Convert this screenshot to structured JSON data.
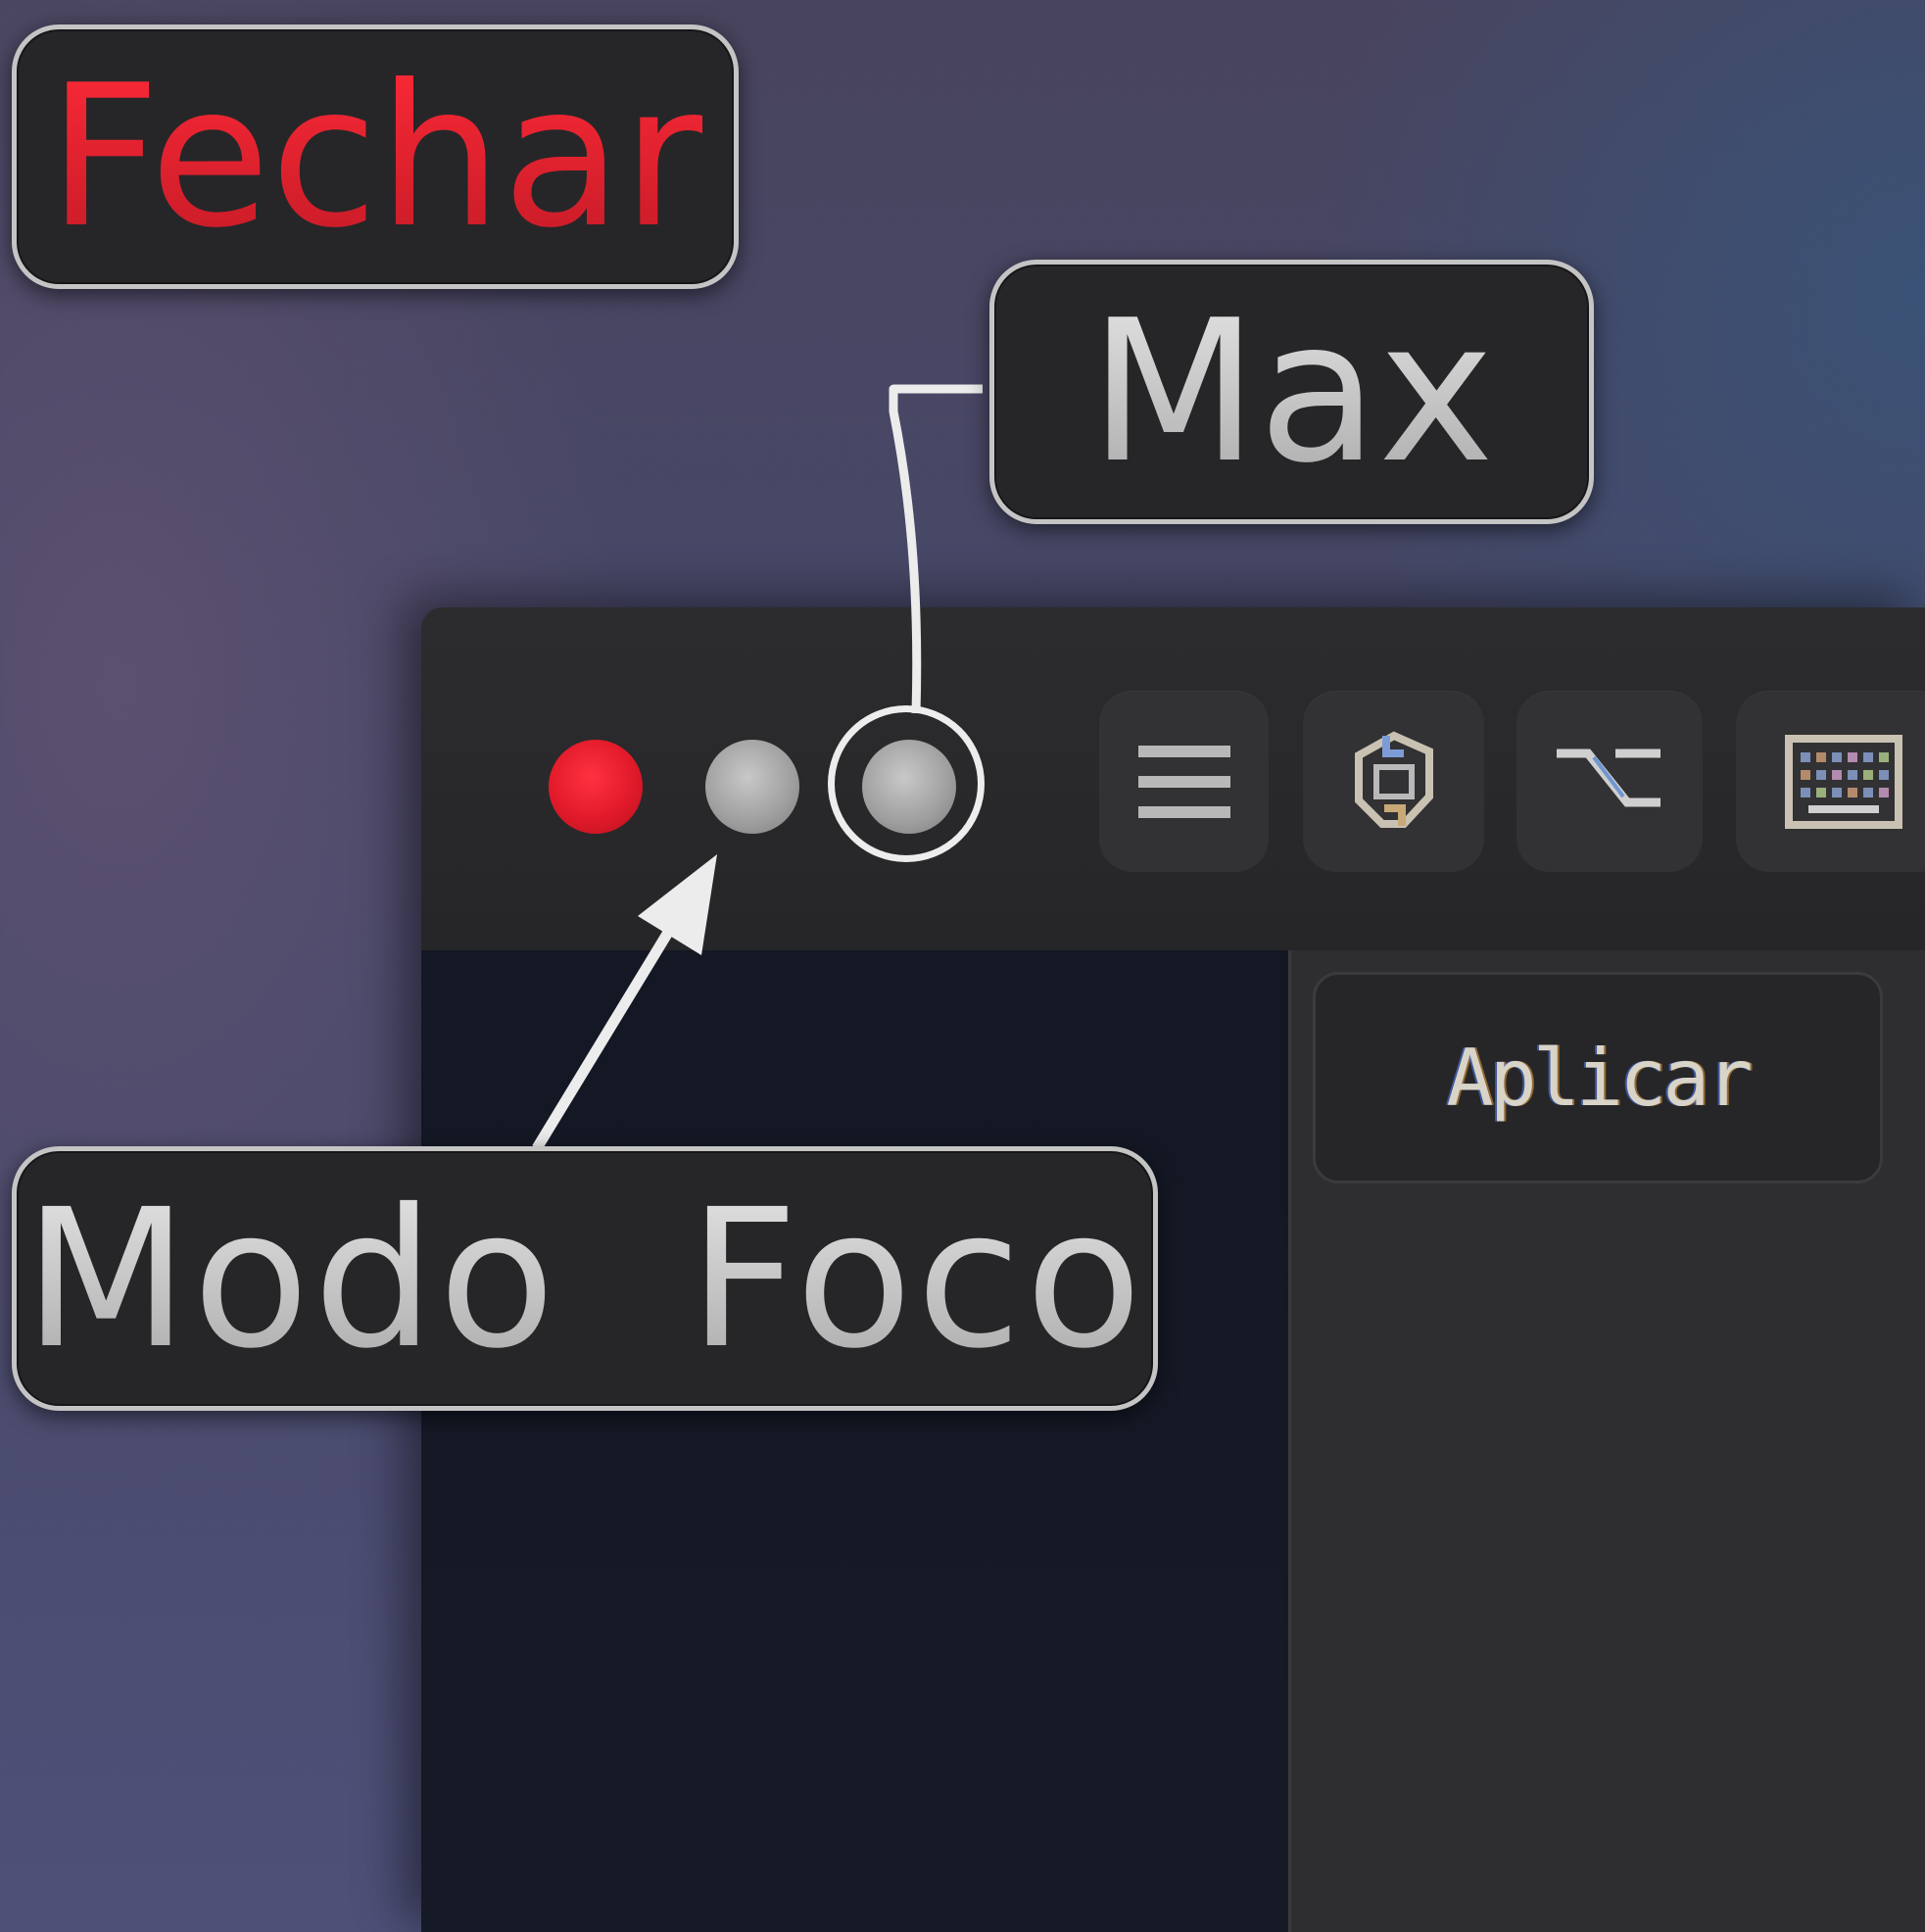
{
  "callouts": {
    "close": "Fechar",
    "maximize": "Max",
    "focus_mode": "Modo  Foco"
  },
  "window": {
    "traffic_lights": [
      {
        "name": "close",
        "color": "#e11a2a"
      },
      {
        "name": "minimize",
        "color": "#9e9e9e"
      },
      {
        "name": "maximize",
        "color": "#9e9e9e"
      }
    ],
    "toolbar": [
      {
        "icon": "menu-icon"
      },
      {
        "icon": "sync-icon"
      },
      {
        "icon": "option-key-icon"
      },
      {
        "icon": "keyboard-icon"
      }
    ],
    "apply_label": "Aplicar"
  },
  "colors": {
    "accent_red": "#d7202c",
    "label_gray": "#bcbcbc",
    "window_bg": "#2b2b2d"
  }
}
